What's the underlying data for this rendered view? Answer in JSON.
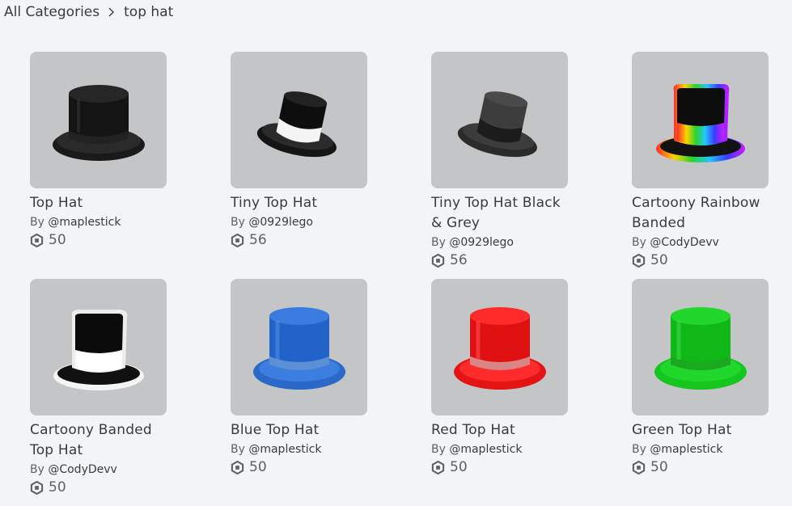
{
  "breadcrumb": {
    "root": "All Categories",
    "separator_icon": "chevron-right-icon",
    "current": "top hat"
  },
  "currency_icon": "robux-icon",
  "items": [
    {
      "name": "Top Hat",
      "by": "By ",
      "creator": "@maplestick",
      "price": "50",
      "hat": "black"
    },
    {
      "name": "Tiny Top Hat",
      "by": "By ",
      "creator": "@0929lego",
      "price": "56",
      "hat": "tiny-black-white"
    },
    {
      "name": "Tiny Top Hat Black & Grey",
      "by": "By ",
      "creator": "@0929lego",
      "price": "56",
      "hat": "tiny-grey"
    },
    {
      "name": "Cartoony Rainbow Banded",
      "by": "By ",
      "creator": "@CodyDevv",
      "price": "50",
      "hat": "rainbow"
    },
    {
      "name": "Cartoony Banded Top Hat",
      "by": "By ",
      "creator": "@CodyDevv",
      "price": "50",
      "hat": "cartoon-white"
    },
    {
      "name": "Blue Top Hat",
      "by": "By ",
      "creator": "@maplestick",
      "price": "50",
      "hat": "blue"
    },
    {
      "name": "Red Top Hat",
      "by": "By ",
      "creator": "@maplestick",
      "price": "50",
      "hat": "red"
    },
    {
      "name": "Green Top Hat",
      "by": "By ",
      "creator": "@maplestick",
      "price": "50",
      "hat": "green"
    }
  ],
  "colors": {
    "page_bg": "#f2f4f5",
    "thumb_bg": "#c4c5c6",
    "text": "#393b3d",
    "muted": "#606162"
  }
}
